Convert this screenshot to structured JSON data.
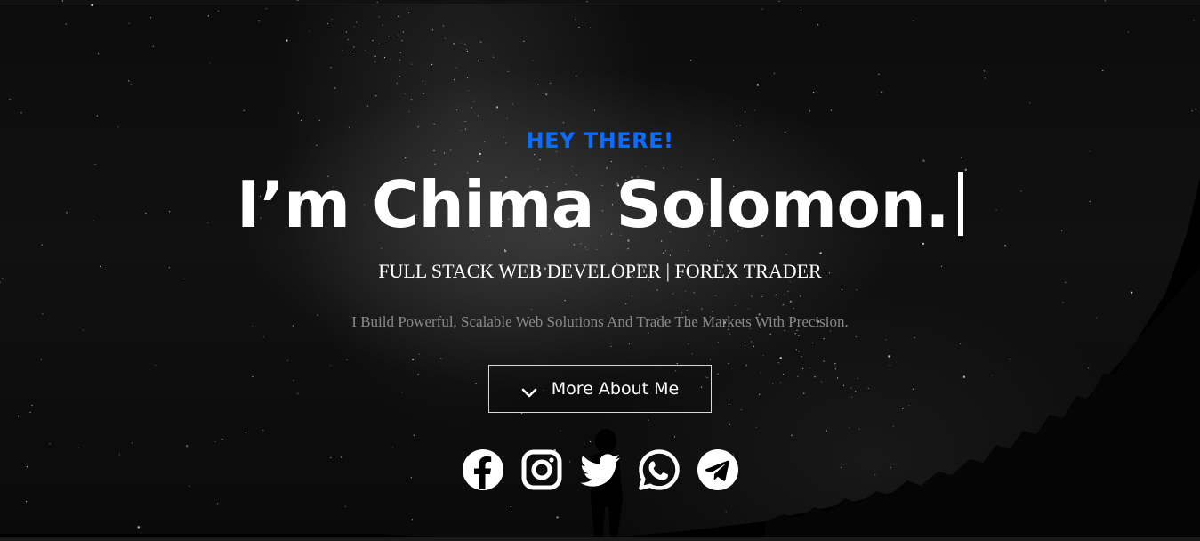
{
  "hero": {
    "kicker": "HEY THERE!",
    "headline": "I’m Chima Solomon.",
    "subtitle": "FULL STACK WEB DEVELOPER | FOREX TRADER",
    "tagline": "I Build Powerful, Scalable Web Solutions And Trade The Markets With Precision.",
    "more_button": {
      "label": "More About Me",
      "icon": "chevron-down-icon"
    }
  },
  "socials": [
    {
      "icon": "facebook-icon"
    },
    {
      "icon": "instagram-icon"
    },
    {
      "icon": "twitter-icon"
    },
    {
      "icon": "whatsapp-icon"
    },
    {
      "icon": "telegram-icon"
    }
  ],
  "colors": {
    "accent": "#0b6dff",
    "text": "#ffffff",
    "muted": "#8a8a8a",
    "background": "#000000"
  }
}
